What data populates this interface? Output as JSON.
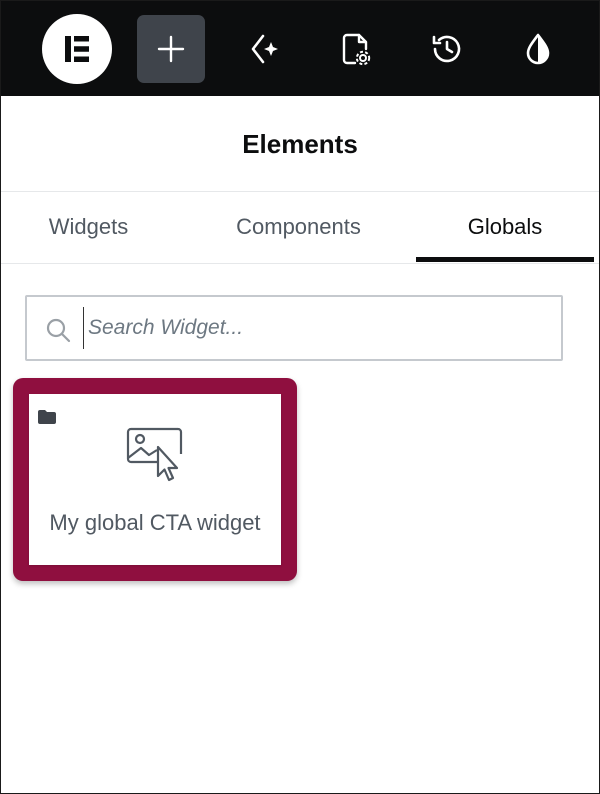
{
  "toolbar": {
    "logo_icon": "elementor-logo-icon",
    "add_icon": "plus-icon",
    "ai_icon": "ai-sparkle-icon",
    "page_settings_icon": "page-settings-icon",
    "history_icon": "history-icon",
    "theme_icon": "drop-icon"
  },
  "panel": {
    "title": "Elements",
    "tabs": [
      {
        "label": "Widgets",
        "active": false
      },
      {
        "label": "Components",
        "active": false
      },
      {
        "label": "Globals",
        "active": true
      }
    ],
    "search": {
      "placeholder": "Search Widget...",
      "value": ""
    },
    "widgets": [
      {
        "label": "My global CTA widget",
        "icon": "global-widget-icon",
        "badge_icon": "folder-icon",
        "highlighted": true
      }
    ]
  },
  "colors": {
    "toolbar_bg": "#0c0d0e",
    "active_button_bg": "#3f444b",
    "highlight": "#8f0f3f",
    "text_muted": "#515962",
    "text_dark": "#0c0d0e"
  }
}
